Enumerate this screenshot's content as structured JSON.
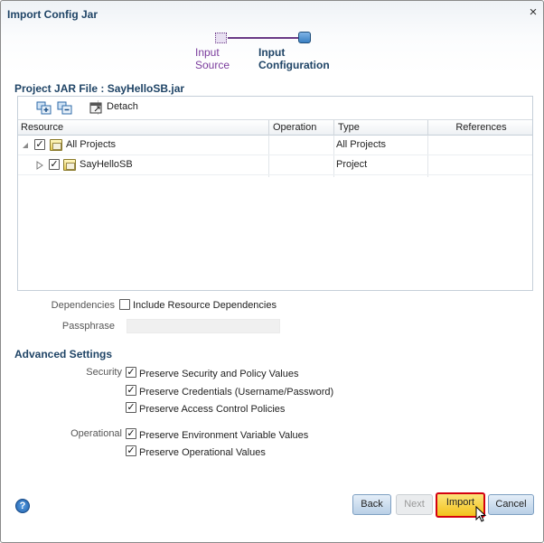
{
  "dialog": {
    "title": "Import Config Jar",
    "close_glyph": "×"
  },
  "train": {
    "steps": [
      {
        "label": "Input Source",
        "state": "visited"
      },
      {
        "label": "Input Configuration",
        "state": "current"
      }
    ]
  },
  "project": {
    "heading": "Project JAR File : SayHelloSB.jar"
  },
  "toolbar": {
    "icons": [
      "expand-all-icon",
      "collapse-all-icon",
      "detach-icon"
    ],
    "detach_label": "Detach"
  },
  "table": {
    "columns": [
      "Resource",
      "Operation",
      "Type",
      "References"
    ],
    "rows": [
      {
        "name": "All Projects",
        "operation": "",
        "type": "All Projects",
        "references": "",
        "checked": true,
        "expand_state": "expanded"
      },
      {
        "name": "SayHelloSB",
        "operation": "",
        "type": "Project",
        "references": "",
        "checked": true,
        "expand_state": "collapsed"
      }
    ]
  },
  "dependencies": {
    "label": "Dependencies",
    "checkbox_label": "Include Resource Dependencies",
    "checked": false
  },
  "passphrase": {
    "label": "Passphrase",
    "value": ""
  },
  "advanced": {
    "heading": "Advanced Settings",
    "security_label": "Security",
    "security_options": [
      {
        "label": "Preserve Security and Policy Values",
        "checked": true
      },
      {
        "label": "Preserve Credentials (Username/Password)",
        "checked": true
      },
      {
        "label": "Preserve Access Control Policies",
        "checked": true
      }
    ],
    "operational_label": "Operational",
    "operational_options": [
      {
        "label": "Preserve Environment Variable Values",
        "checked": true
      },
      {
        "label": "Preserve Operational Values",
        "checked": true
      }
    ]
  },
  "footer": {
    "help_glyph": "?",
    "back_label": "Back",
    "next_label": "Next",
    "import_label": "Import",
    "cancel_label": "Cancel"
  },
  "colors": {
    "accent": "#1f4466",
    "visited_step": "#7a3b9c",
    "highlight_border": "#d4000f"
  }
}
